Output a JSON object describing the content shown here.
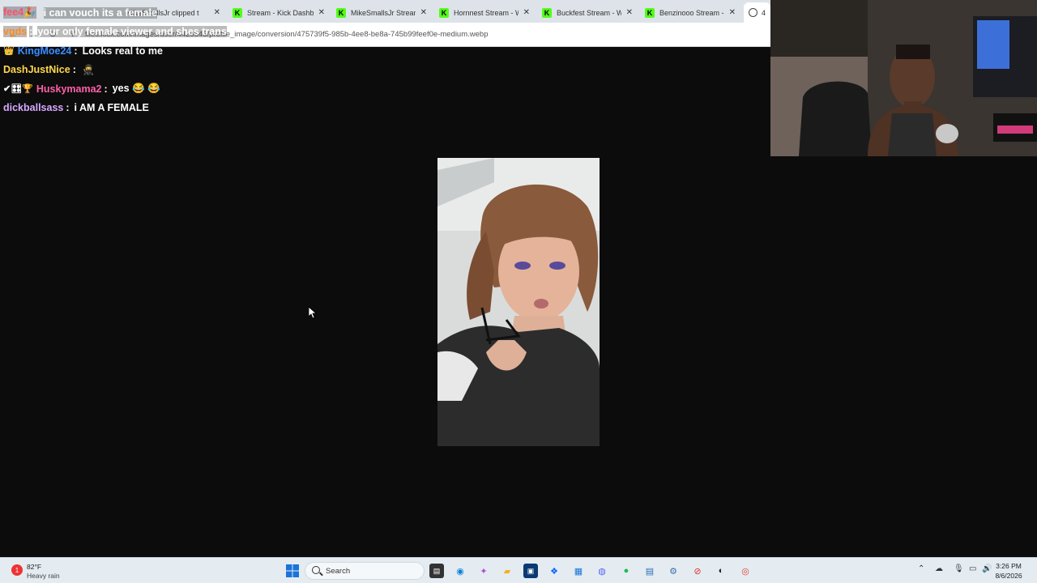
{
  "browser": {
    "tabs": [
      {
        "label": "MikeSmallsJr clipped t",
        "icon": "globe"
      },
      {
        "label": "Stream - Kick Dashbo",
        "icon": "kick"
      },
      {
        "label": "MikeSmallsJr Stream -",
        "icon": "kick"
      },
      {
        "label": "Hornnest Stream - Wa",
        "icon": "kick"
      },
      {
        "label": "Buckfest Stream - War",
        "icon": "kick"
      },
      {
        "label": "Benzinooo Stream - W",
        "icon": "kick"
      },
      {
        "label": "47",
        "icon": "globe"
      }
    ],
    "url": "files.kick.com/images/user/4425645/profile_image/conversion/475739f5-985b-4ee8-be8a-745b99feef0e-medium.webp"
  },
  "chat": [
    {
      "badge": "",
      "user": "fee4🎉",
      "user_color": "red",
      "message": "i can vouch its a female",
      "highlight": true
    },
    {
      "badge": "",
      "user": "vgds",
      "user_color": "orange",
      "message": "your only female viewer and shes trans",
      "highlight": true
    },
    {
      "badge": "👑",
      "user": "KingMoe24",
      "user_color": "blue",
      "message": "Looks real to me",
      "highlight": false
    },
    {
      "badge": "",
      "user": "DashJustNice",
      "user_color": "yellow",
      "message": "🥷",
      "highlight": false
    },
    {
      "badge": "✔🎛🏆",
      "user": "Huskymama2",
      "user_color": "pink",
      "message": "yes 😂 😂",
      "highlight": false
    },
    {
      "badge": "",
      "user": "dickballsass",
      "user_color": "lilac",
      "message": "i AM A FEMALE",
      "highlight": false
    }
  ],
  "taskbar": {
    "weather_temp": "82°F",
    "weather_desc": "Heavy rain",
    "weather_badge": "1",
    "search_placeholder": "Search",
    "time": "3:26 PM",
    "date": "8/6/2026"
  }
}
